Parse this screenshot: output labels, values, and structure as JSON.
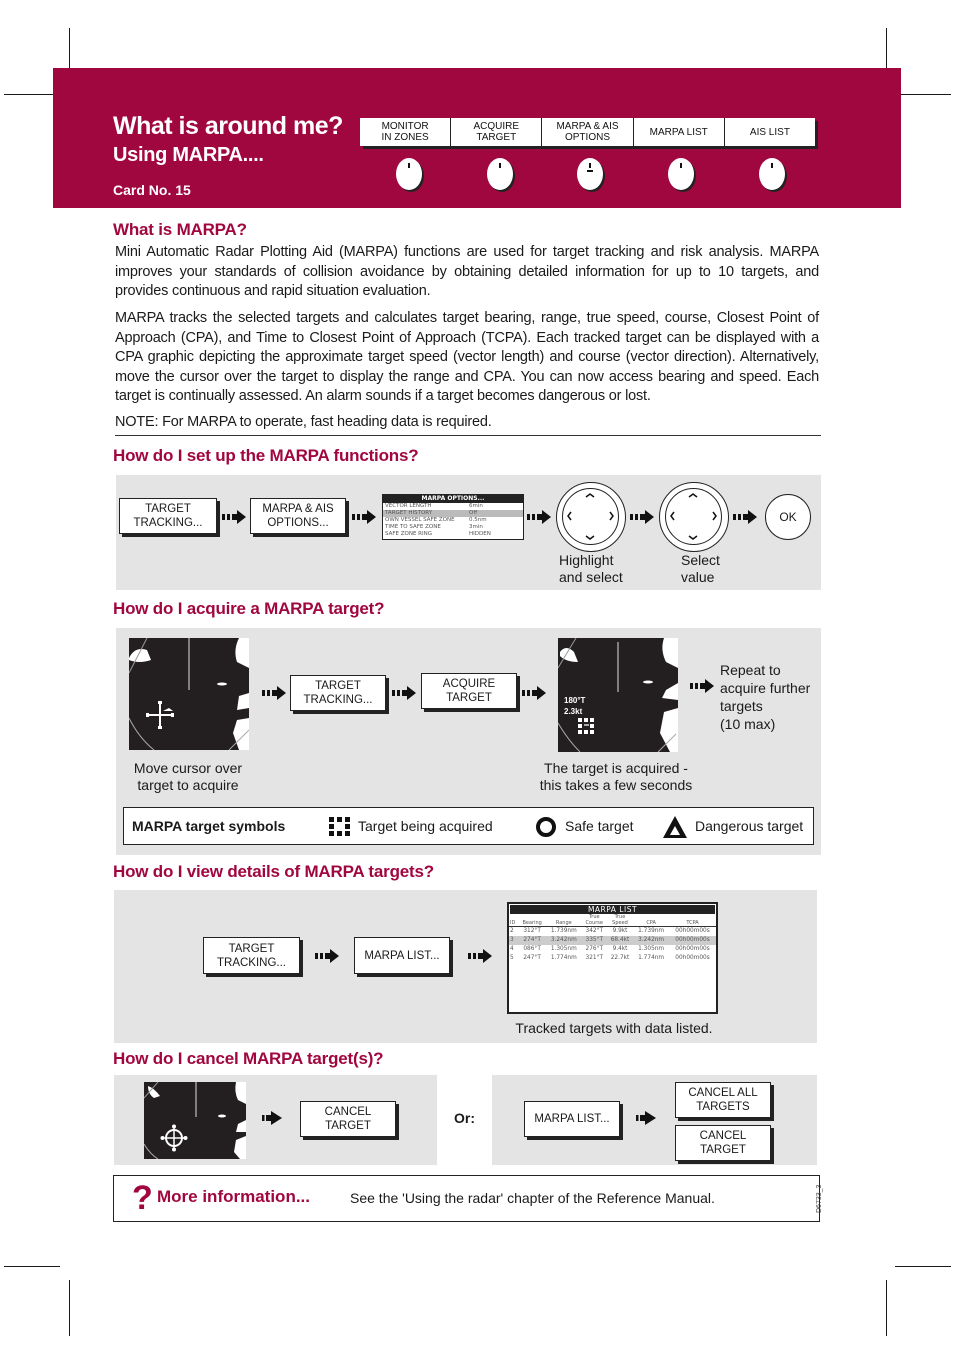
{
  "header": {
    "title": "What is around me?",
    "subtitle": "Using MARPA....",
    "card_number": "Card No. 15",
    "brand_color": "#a1073f",
    "softkeys": [
      {
        "line1": "MONITOR",
        "line2": "IN ZONES"
      },
      {
        "line1": "ACQUIRE TARGET",
        "line2": ""
      },
      {
        "line1": "MARPA & AIS",
        "line2": "OPTIONS"
      },
      {
        "line1": "MARPA LIST",
        "line2": ""
      },
      {
        "line1": "AIS LIST",
        "line2": ""
      }
    ]
  },
  "what_is": {
    "heading": "What is MARPA?",
    "paragraph1": "Mini Automatic Radar Plotting Aid (MARPA) functions are used for target tracking and risk analysis. MARPA improves your standards of collision avoidance by obtaining detailed information for up to 10 targets, and provides continuous and rapid situation evaluation.",
    "paragraph2": "MARPA tracks the selected targets and calculates target bearing, range, true speed, course, Closest Point of Approach (CPA), and Time to Closest Point of Approach (TCPA). Each tracked target can be displayed with a CPA graphic depicting the approximate target speed (vector length) and course (vector direction). Alternatively, move the cursor over the target to display the range and CPA. You can now access bearing and speed. Each target is continually assessed. An alarm sounds if a target becomes dangerous or lost.",
    "note": "NOTE: For MARPA to operate, fast heading data is required."
  },
  "setup": {
    "heading": "How do I set up the MARPA functions?",
    "btn_target_tracking": {
      "line1": "TARGET",
      "line2": "TRACKING..."
    },
    "btn_marpa_ais": {
      "line1": "MARPA & AIS",
      "line2": "OPTIONS..."
    },
    "options_screen": {
      "title": "MARPA OPTIONS...",
      "rows": [
        {
          "label": "VECTOR LENGTH",
          "value": "6min",
          "highlighted": false
        },
        {
          "label": "TARGET HISTORY",
          "value": "Off",
          "highlighted": true
        },
        {
          "label": "OWN VESSEL SAFE ZONE",
          "value": "0.5nm",
          "highlighted": false
        },
        {
          "label": "TIME TO SAFE ZONE",
          "value": "3min",
          "highlighted": false
        },
        {
          "label": "SAFE ZONE RING",
          "value": "HIDDEN",
          "highlighted": false
        }
      ]
    },
    "caption_highlight": {
      "line1": "Highlight",
      "line2": "and select"
    },
    "caption_select": {
      "line1": "Select",
      "line2": "value"
    },
    "ok_label": "OK"
  },
  "acquire": {
    "heading": "How do I acquire a MARPA target?",
    "btn_target_tracking": {
      "line1": "TARGET",
      "line2": "TRACKING..."
    },
    "btn_acquire": "ACQUIRE TARGET",
    "radar_readout": {
      "bearing": "180°T",
      "speed": "2.3kt"
    },
    "caption_move": {
      "line1": "Move cursor over",
      "line2": "target to acquire"
    },
    "caption_acquired": {
      "line1": "The target is acquired -",
      "line2": "this takes a few seconds"
    },
    "repeat": {
      "line1": "Repeat to",
      "line2": "acquire further",
      "line3": "targets",
      "line4": "(10 max)"
    },
    "symbols": {
      "label": "MARPA target symbols",
      "acquiring": "Target being acquired",
      "safe": "Safe target",
      "dangerous": "Dangerous target"
    }
  },
  "view": {
    "heading": "How do I view details of MARPA targets?",
    "btn_target_tracking": {
      "line1": "TARGET",
      "line2": "TRACKING..."
    },
    "btn_marpa_list": "MARPA LIST...",
    "list_screen": {
      "title": "MARPA LIST",
      "columns": [
        {
          "top": "",
          "bottom": "ID"
        },
        {
          "top": "",
          "bottom": "Bearing"
        },
        {
          "top": "",
          "bottom": "Range"
        },
        {
          "top": "True",
          "bottom": "Course"
        },
        {
          "top": "True",
          "bottom": "Speed"
        },
        {
          "top": "",
          "bottom": "CPA"
        },
        {
          "top": "",
          "bottom": "TCPA"
        }
      ],
      "rows": [
        {
          "id": "2",
          "bearing": "312°T",
          "range": "1.739nm",
          "course": "342°T",
          "speed": "9.9kt",
          "cpa": "1.739nm",
          "tcpa": "00h00m00s",
          "highlighted": false
        },
        {
          "id": "3",
          "bearing": "274°T",
          "range": "3.242nm",
          "course": "335°T",
          "speed": "68.4kt",
          "cpa": "3.242nm",
          "tcpa": "00h00m00s",
          "highlighted": true
        },
        {
          "id": "4",
          "bearing": "086°T",
          "range": "1.305nm",
          "course": "276°T",
          "speed": "9.4kt",
          "cpa": "1.305nm",
          "tcpa": "00h00m00s",
          "highlighted": false
        },
        {
          "id": "5",
          "bearing": "247°T",
          "range": "1.774nm",
          "course": "321°T",
          "speed": "22.7kt",
          "cpa": "1.774nm",
          "tcpa": "00h00m00s",
          "highlighted": false
        }
      ]
    },
    "caption": "Tracked targets with data listed."
  },
  "cancel": {
    "heading": "How do I cancel MARPA target(s)?",
    "btn_cancel_target": "CANCEL TARGET",
    "or_label": "Or:",
    "btn_marpa_list": "MARPA LIST...",
    "btn_cancel_all": {
      "line1": "CANCEL ALL",
      "line2": "TARGETS"
    },
    "btn_cancel_target2": "CANCEL TARGET"
  },
  "more_info": {
    "icon": "question-mark-icon",
    "label": "More information...",
    "text": "See the 'Using the radar' chapter of the Reference Manual."
  },
  "doc_code": "D6733_3"
}
